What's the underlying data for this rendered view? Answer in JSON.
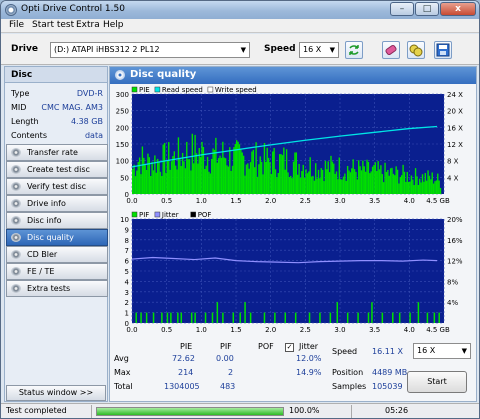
{
  "window": {
    "title": "Opti Drive Control 1.50",
    "minimize": "–",
    "maximize": "□",
    "close": "x"
  },
  "menu": [
    "File",
    "Start test",
    "Extra",
    "Help"
  ],
  "toolbar": {
    "drive_label": "Drive",
    "drive_value": "(D:)   ATAPI iHBS312   2 PL12",
    "speed_label": "Speed",
    "speed_value": "16 X"
  },
  "disc": {
    "header": "Disc",
    "rows": [
      {
        "label": "Type",
        "value": "DVD-R"
      },
      {
        "label": "MID",
        "value": "CMC MAG. AM3"
      },
      {
        "label": "Length",
        "value": "4.38 GB"
      },
      {
        "label": "Contents",
        "value": "data"
      }
    ]
  },
  "nav": [
    "Transfer rate",
    "Create test disc",
    "Verify test disc",
    "Drive info",
    "Disc info",
    "Disc quality",
    "CD Bler",
    "FE / TE",
    "Extra tests"
  ],
  "nav_active": "Disc quality",
  "status_window_button": "Status window >>",
  "panel": {
    "title": "Disc quality"
  },
  "chart_data": [
    {
      "type": "bar",
      "legend": [
        "PIE",
        "Read speed",
        "Write speed"
      ],
      "colors": {
        "PIE": "#00e000",
        "Read speed": "#00e5e5",
        "Write speed": "#ffffff",
        "background": "#0a1f8f"
      },
      "x_ticks": [
        "0.0",
        "0.5",
        "1.0",
        "1.5",
        "2.0",
        "2.5",
        "3.0",
        "3.5",
        "4.0",
        "4.5 GB"
      ],
      "y_ticks": [
        "300",
        "250",
        "200",
        "150",
        "100",
        "50",
        "0"
      ],
      "y2_ticks": [
        "24 X",
        "20 X",
        "16 X",
        "12 X",
        "8 X",
        "4 X"
      ],
      "xlim": [
        0,
        4.5
      ],
      "ylim": [
        0,
        300
      ],
      "y2lim": [
        0,
        24
      ],
      "pie_profile": [
        [
          0,
          105
        ],
        [
          0.1,
          150
        ],
        [
          0.2,
          128
        ],
        [
          0.3,
          135
        ],
        [
          0.4,
          138
        ],
        [
          0.5,
          145
        ],
        [
          0.6,
          150
        ],
        [
          0.7,
          160
        ],
        [
          0.8,
          170
        ],
        [
          0.9,
          175
        ],
        [
          1.0,
          170
        ],
        [
          1.1,
          160
        ],
        [
          1.2,
          158
        ],
        [
          1.3,
          160
        ],
        [
          1.4,
          155
        ],
        [
          1.5,
          150
        ],
        [
          1.6,
          150
        ],
        [
          1.7,
          148
        ],
        [
          1.8,
          145
        ],
        [
          1.9,
          140
        ],
        [
          2.0,
          135
        ],
        [
          2.1,
          135
        ],
        [
          2.2,
          140
        ],
        [
          2.3,
          130
        ],
        [
          2.4,
          125
        ],
        [
          2.5,
          120
        ],
        [
          2.6,
          115
        ],
        [
          2.7,
          110
        ],
        [
          2.8,
          108
        ],
        [
          2.9,
          110
        ],
        [
          3.0,
          108
        ],
        [
          3.1,
          105
        ],
        [
          3.2,
          100
        ],
        [
          3.3,
          98
        ],
        [
          3.4,
          95
        ],
        [
          3.5,
          92
        ],
        [
          3.6,
          88
        ],
        [
          3.7,
          85
        ],
        [
          3.8,
          82
        ],
        [
          3.9,
          80
        ],
        [
          4.0,
          75
        ],
        [
          4.1,
          72
        ],
        [
          4.2,
          70
        ],
        [
          4.3,
          68
        ],
        [
          4.4,
          60
        ],
        [
          4.45,
          40
        ]
      ],
      "read_speed": [
        [
          0,
          6.5
        ],
        [
          0.5,
          8.0
        ],
        [
          1.0,
          9.4
        ],
        [
          1.5,
          10.6
        ],
        [
          2.0,
          11.8
        ],
        [
          2.5,
          12.9
        ],
        [
          3.0,
          13.9
        ],
        [
          3.5,
          14.8
        ],
        [
          4.0,
          15.7
        ],
        [
          4.4,
          16.2
        ]
      ]
    },
    {
      "type": "bar",
      "legend": [
        "PIF",
        "Jitter",
        "POF"
      ],
      "colors": {
        "PIF": "#00e000",
        "Jitter": "#9090ff",
        "POF": "#000000",
        "background": "#0a1f8f"
      },
      "x_ticks": [
        "0.0",
        "0.5",
        "1.0",
        "1.5",
        "2.0",
        "2.5",
        "3.0",
        "3.5",
        "4.0",
        "4.5 GB"
      ],
      "y_ticks": [
        "10",
        "9",
        "8",
        "7",
        "6",
        "5",
        "4",
        "3",
        "2",
        "1",
        "0"
      ],
      "y2_ticks": [
        "20%",
        "16%",
        "12%",
        "8%",
        "4%"
      ],
      "xlim": [
        0,
        4.5
      ],
      "ylim": [
        0,
        10
      ],
      "y2lim": [
        0,
        20
      ],
      "pif_events": [
        [
          0.05,
          1
        ],
        [
          0.12,
          1
        ],
        [
          0.2,
          1
        ],
        [
          0.3,
          1
        ],
        [
          0.42,
          1
        ],
        [
          0.5,
          1
        ],
        [
          0.55,
          1
        ],
        [
          0.65,
          1
        ],
        [
          0.7,
          1
        ],
        [
          0.85,
          1
        ],
        [
          0.9,
          1
        ],
        [
          1.05,
          1
        ],
        [
          1.15,
          1
        ],
        [
          1.22,
          2
        ],
        [
          1.3,
          1
        ],
        [
          1.45,
          1
        ],
        [
          1.55,
          1
        ],
        [
          1.62,
          2
        ],
        [
          1.7,
          1
        ],
        [
          1.9,
          1
        ],
        [
          2.05,
          1
        ],
        [
          2.2,
          1
        ],
        [
          2.35,
          1
        ],
        [
          2.55,
          1
        ],
        [
          2.7,
          1
        ],
        [
          2.85,
          1
        ],
        [
          2.95,
          2
        ],
        [
          3.1,
          1
        ],
        [
          3.25,
          1
        ],
        [
          3.4,
          1
        ],
        [
          3.45,
          2
        ],
        [
          3.6,
          1
        ],
        [
          3.75,
          1
        ],
        [
          3.85,
          1
        ],
        [
          4.0,
          1
        ],
        [
          4.12,
          2
        ],
        [
          4.25,
          1
        ],
        [
          4.35,
          1
        ],
        [
          4.42,
          1
        ]
      ],
      "jitter": [
        [
          0,
          12.3
        ],
        [
          0.3,
          12.6
        ],
        [
          0.6,
          12.4
        ],
        [
          0.9,
          12.2
        ],
        [
          1.2,
          12.5
        ],
        [
          1.5,
          12.0
        ],
        [
          1.8,
          11.8
        ],
        [
          2.1,
          11.7
        ],
        [
          2.4,
          11.6
        ],
        [
          2.7,
          11.8
        ],
        [
          3.0,
          11.9
        ],
        [
          3.3,
          12.0
        ],
        [
          3.6,
          12.0
        ],
        [
          3.9,
          11.9
        ],
        [
          4.2,
          12.1
        ],
        [
          4.4,
          12.0
        ]
      ]
    }
  ],
  "stats": {
    "headers": [
      "PIE",
      "PIF",
      "POF",
      "Jitter"
    ],
    "rows": [
      {
        "label": "Avg",
        "pie": "72.62",
        "pif": "0.00",
        "pof": "",
        "jitter": "12.0%"
      },
      {
        "label": "Max",
        "pie": "214",
        "pif": "2",
        "pof": "",
        "jitter": "14.9%"
      },
      {
        "label": "Total",
        "pie": "1304005",
        "pif": "483",
        "pof": "",
        "jitter": ""
      }
    ],
    "jitter_checked": "✓",
    "speed_label": "Speed",
    "speed_value": "16.11 X",
    "position_label": "Position",
    "position_value": "4489 MB",
    "samples_label": "Samples",
    "samples_value": "105039",
    "speed_select": "16 X",
    "start_label": "Start"
  },
  "statusbar": {
    "status": "Test completed",
    "progress_pct": 100,
    "progress_text": "100.0%",
    "time": "05:26"
  }
}
